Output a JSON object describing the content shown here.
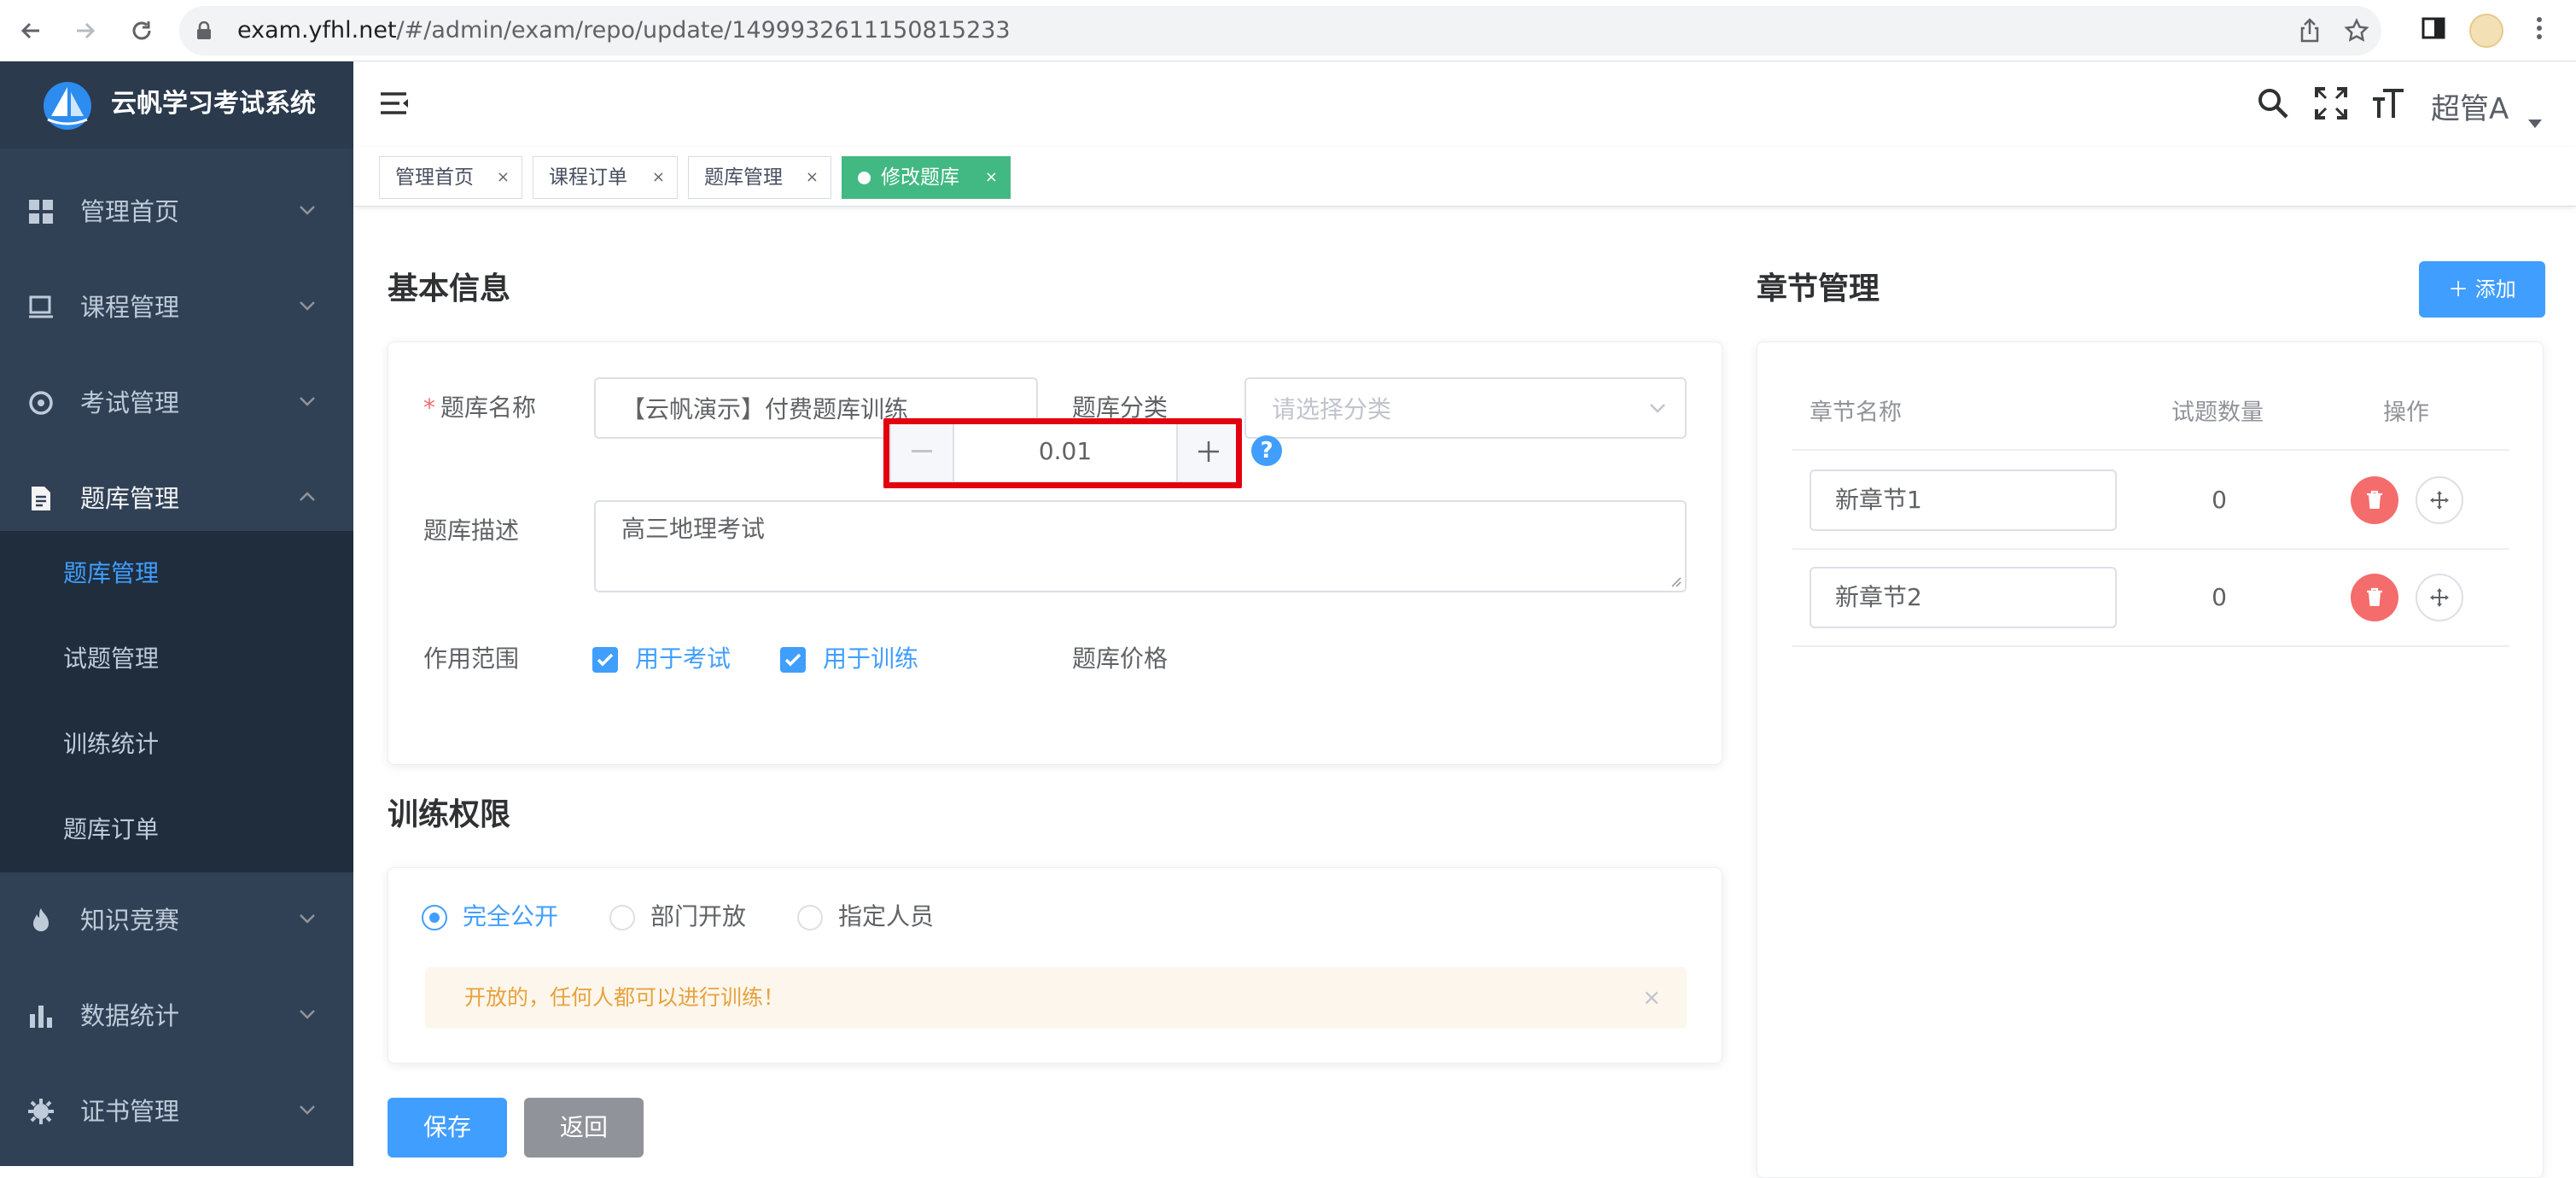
{
  "browser": {
    "url_host": "exam.yfhl.net",
    "url_path": "/#/admin/exam/repo/update/1499932611150815233",
    "icons": [
      "back-arrow-icon",
      "forward-arrow-icon",
      "reload-icon",
      "lock-icon",
      "share-icon",
      "star-icon",
      "sidebar-toggle-icon",
      "avatar",
      "more-icon"
    ]
  },
  "app": {
    "title": "云帆学习考试系统"
  },
  "sidebar": {
    "items": [
      {
        "label": "管理首页",
        "icon": "dashboard-icon"
      },
      {
        "label": "课程管理",
        "icon": "monitor-icon"
      },
      {
        "label": "考试管理",
        "icon": "target-icon"
      },
      {
        "label": "题库管理",
        "icon": "document-icon"
      },
      {
        "label": "知识竞赛",
        "icon": "fire-icon"
      },
      {
        "label": "数据统计",
        "icon": "bar-chart-icon"
      },
      {
        "label": "证书管理",
        "icon": "gear-icon"
      }
    ],
    "submenu": [
      {
        "label": "题库管理"
      },
      {
        "label": "试题管理"
      },
      {
        "label": "训练统计"
      },
      {
        "label": "题库订单"
      }
    ]
  },
  "topbar": {
    "username": "超管A"
  },
  "tags": [
    {
      "label": "管理首页"
    },
    {
      "label": "课程订单"
    },
    {
      "label": "题库管理"
    },
    {
      "label": "修改题库"
    }
  ],
  "tag_close": "×",
  "basic": {
    "title": "基本信息",
    "required_mark": "*",
    "name_label": "题库名称",
    "name_value": "【云帆演示】付费题库训练",
    "category_label": "题库分类",
    "category_placeholder": "请选择分类",
    "desc_label": "题库描述",
    "desc_value": "高三地理考试",
    "scope_label": "作用范围",
    "scope_exam": "用于考试",
    "scope_train": "用于训练",
    "price_label": "题库价格",
    "price_value": "0.01",
    "help": "?"
  },
  "permission": {
    "title": "训练权限",
    "options": [
      "完全公开",
      "部门开放",
      "指定人员"
    ],
    "selected": 0,
    "alert_text": "开放的，任何人都可以进行训练！",
    "alert_close": "×"
  },
  "actions": {
    "save": "保存",
    "back": "返回"
  },
  "chapters": {
    "title": "章节管理",
    "add_label": "＋ 添加",
    "headers": [
      "章节名称",
      "试题数量",
      "操作"
    ],
    "rows": [
      {
        "name": "新章节1",
        "count": "0"
      },
      {
        "name": "新章节2",
        "count": "0"
      }
    ]
  },
  "colors": {
    "primary": "#409eff",
    "sidebar_bg": "#304156",
    "sidebar_sub_bg": "#1f2d3d",
    "active_tag": "#42b983",
    "danger": "#f56c6c",
    "warning": "#e6a23c",
    "highlight": "#e3000f"
  }
}
